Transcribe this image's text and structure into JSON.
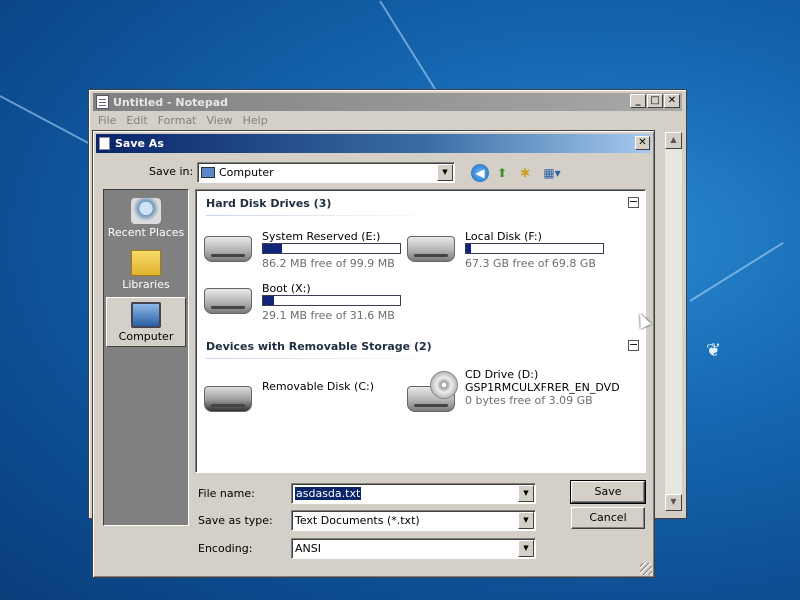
{
  "notepad": {
    "title": "Untitled - Notepad",
    "menu": [
      "File",
      "Edit",
      "Format",
      "View",
      "Help"
    ]
  },
  "dialog": {
    "title": "Save As",
    "save_in_label": "Save in:",
    "save_in_value": "Computer",
    "toolbar_icons": [
      "back-icon",
      "up-folder-icon",
      "new-folder-icon",
      "view-menu-icon"
    ],
    "places": [
      {
        "label": "Recent Places",
        "icon": "recent-places-icon",
        "selected": false
      },
      {
        "label": "Libraries",
        "icon": "libraries-icon",
        "selected": false
      },
      {
        "label": "Computer",
        "icon": "computer-icon",
        "selected": true
      }
    ],
    "groups": [
      {
        "header": "Hard Disk Drives (3)",
        "drives": [
          {
            "name": "System Reserved (E:)",
            "free": "86.2 MB free of 99.9 MB",
            "used_fraction": 0.14
          },
          {
            "name": "Local Disk (F:)",
            "free": "67.3 GB free of 69.8 GB",
            "used_fraction": 0.04
          },
          {
            "name": "Boot (X:)",
            "free": "29.1 MB free of 31.6 MB",
            "used_fraction": 0.08
          }
        ]
      },
      {
        "header": "Devices with Removable Storage (2)",
        "drives": [
          {
            "name": "Removable Disk (C:)",
            "icon": "removable-disk-icon"
          },
          {
            "name": "CD Drive (D:)",
            "label2": "GSP1RMCULXFRER_EN_DVD",
            "free": "0 bytes free of 3.09 GB",
            "icon": "cd-drive-icon"
          }
        ]
      }
    ],
    "file_name_label": "File name:",
    "file_name_value": "asdasda.txt",
    "save_as_type_label": "Save as type:",
    "save_as_type_value": "Text Documents (*.txt)",
    "encoding_label": "Encoding:",
    "encoding_value": "ANSI",
    "save_button": "Save",
    "cancel_button": "Cancel"
  }
}
